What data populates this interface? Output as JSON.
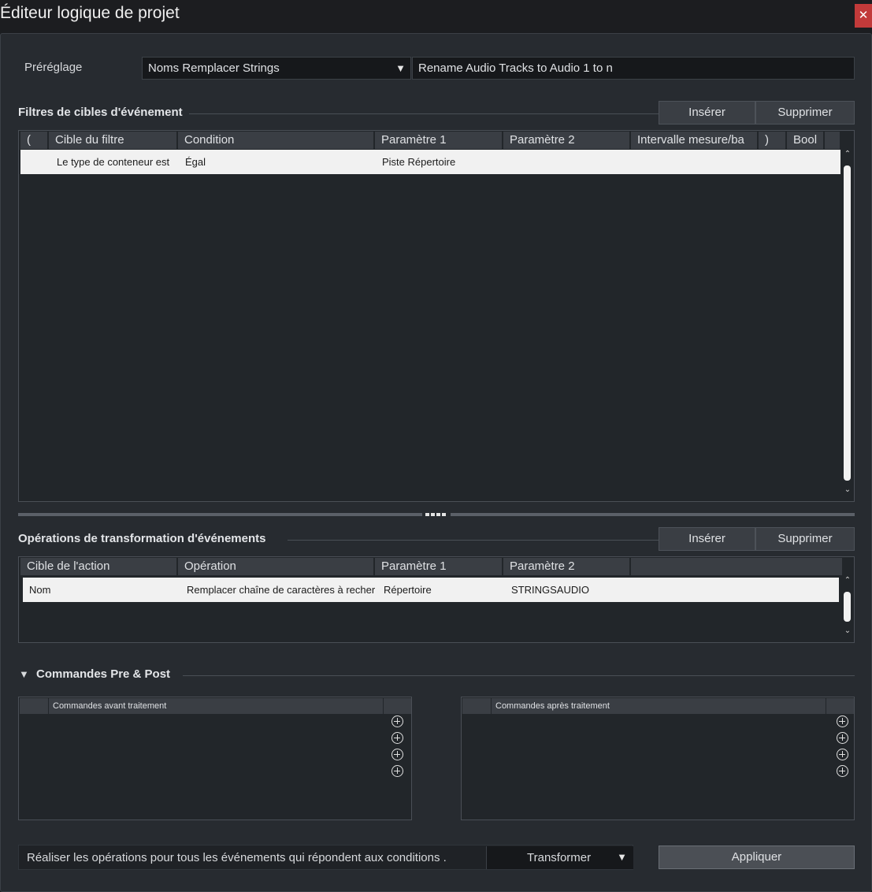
{
  "window": {
    "title": "Éditeur logique de projet",
    "close_glyph": "✕"
  },
  "preset": {
    "label": "Préréglage",
    "selected": "Noms Remplacer Strings",
    "description": "Rename Audio Tracks to Audio 1 to n"
  },
  "filters": {
    "title": "Filtres de cibles d'événement",
    "insert_label": "Insérer",
    "delete_label": "Supprimer",
    "columns": [
      "(",
      "Cible du filtre",
      "Condition",
      "Paramètre 1",
      "Paramètre 2",
      "Intervalle mesure/ba",
      ")",
      "Bool"
    ],
    "rows": [
      {
        "open": "",
        "target": "Le type de conteneur est",
        "condition": "Égal",
        "param1": "Piste Répertoire",
        "param2": "",
        "range": "",
        "close": "",
        "bool": ""
      }
    ]
  },
  "actions": {
    "title": "Opérations de transformation d'événements",
    "insert_label": "Insérer",
    "delete_label": "Supprimer",
    "columns": [
      "Cible de l'action",
      "Opération",
      "Paramètre 1",
      "Paramètre 2"
    ],
    "rows": [
      {
        "target": "Nom",
        "operation": "Remplacer chaîne de caractères à recher",
        "param1": "Répertoire",
        "param2": "STRINGSAUDIO"
      }
    ]
  },
  "prepost": {
    "title": "Commandes Pre & Post",
    "collapse_glyph": "▼",
    "pre_header": "Commandes avant traitement",
    "post_header": "Commandes après traitement"
  },
  "footer": {
    "description": "Réaliser les opérations pour tous les événements qui répondent aux conditions .",
    "function_selected": "Transformer",
    "apply_label": "Appliquer"
  },
  "glyphs": {
    "dropdown": "▼",
    "scroll_up": "⌃",
    "scroll_down": "⌄"
  },
  "icons": {
    "add": "plus-circle-icon",
    "close": "close-icon"
  },
  "colors": {
    "background": "#272b30",
    "selected_row": "#f1f1f1",
    "close_button": "#c23a3a"
  }
}
